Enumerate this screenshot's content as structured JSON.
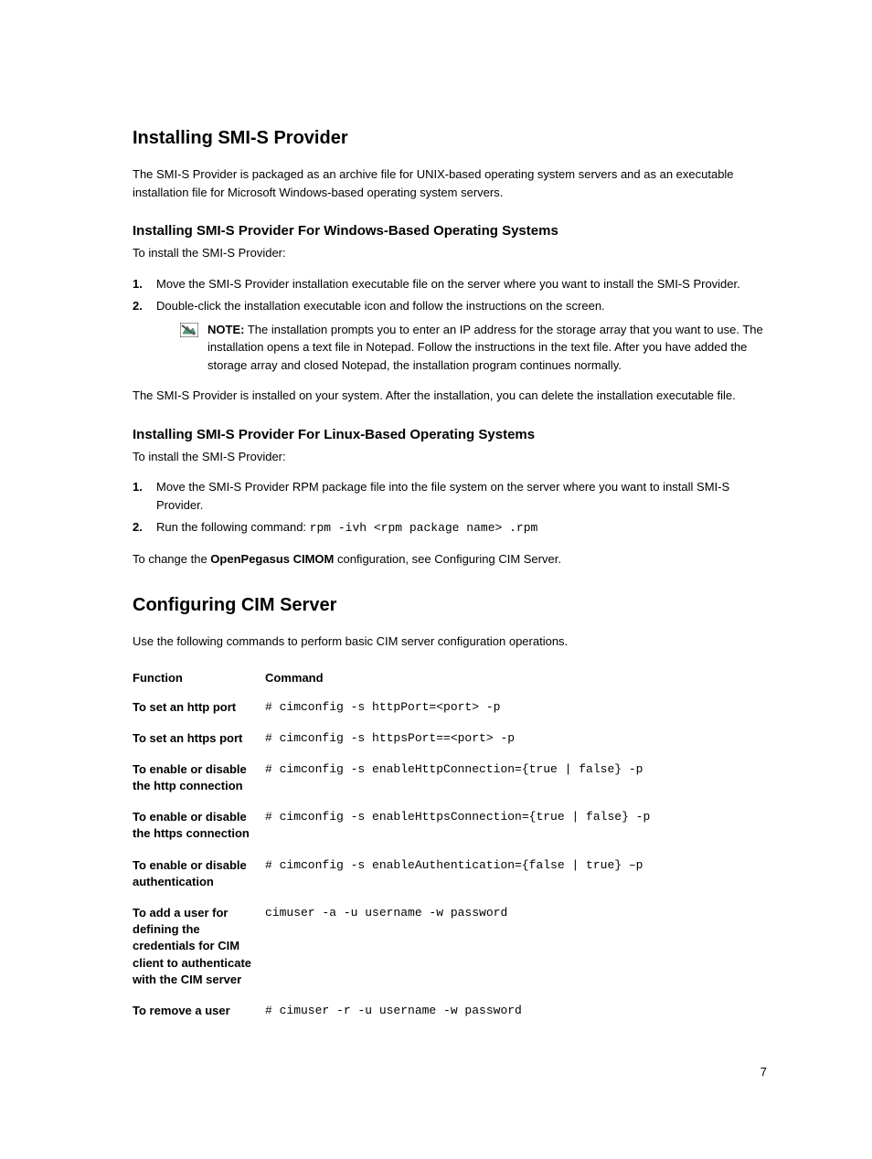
{
  "h1": "Installing SMI-S Provider",
  "intro": "The SMI-S Provider is packaged as an archive file for UNIX-based operating system servers and as an executable installation file for Microsoft Windows-based operating system servers.",
  "win": {
    "heading": "Installing SMI-S Provider For Windows-Based Operating Systems",
    "lead": "To install the SMI-S Provider:",
    "step1": "Move the SMI-S Provider installation executable file on the server where you want to install the SMI-S Provider.",
    "step2": "Double-click the installation executable icon and follow the instructions on the screen.",
    "note_label": "NOTE:",
    "note_body": " The installation prompts you to enter an IP address for the storage array that you want to use. The installation opens a text file in Notepad. Follow the instructions in the text file. After you have added the storage array and closed Notepad, the installation program continues normally.",
    "after": "The SMI-S Provider is installed on your system. After the installation, you can delete the installation executable file."
  },
  "linux": {
    "heading": "Installing SMI-S Provider For Linux-Based Operating Systems",
    "lead": "To install the SMI-S Provider:",
    "step1": "Move the SMI-S Provider RPM package file into the file system on the server where you want to install SMI-S Provider.",
    "step2_pre": "Run the following command: ",
    "step2_code": "rpm -ivh <rpm package name> .rpm",
    "after_pre": "To change the ",
    "after_bold": "OpenPegasus CIMOM",
    "after_post": " configuration, see Configuring CIM Server."
  },
  "cim": {
    "heading": "Configuring CIM Server",
    "lead": "Use the following commands to perform basic CIM server configuration operations.",
    "th_func": "Function",
    "th_cmd": "Command",
    "rows": [
      {
        "func": "To set an http port",
        "cmd": "# cimconfig -s httpPort=<port> -p"
      },
      {
        "func": "To set an https port",
        "cmd": "# cimconfig -s httpsPort==<port> -p"
      },
      {
        "func": "To enable or disable the http connection",
        "cmd": "# cimconfig -s enableHttpConnection={true | false} -p"
      },
      {
        "func": "To enable or disable the https connection",
        "cmd": "# cimconfig -s enableHttpsConnection={true | false} -p"
      },
      {
        "func": "To enable or disable authentication",
        "cmd": "# cimconfig -s enableAuthentication={false | true} –p"
      },
      {
        "func": "To add a user for defining the credentials for CIM client to authenticate with the CIM server",
        "cmd": "cimuser -a -u username -w password"
      },
      {
        "func": "To remove a user",
        "cmd": "# cimuser -r -u username -w password"
      }
    ]
  },
  "page_number": "7"
}
